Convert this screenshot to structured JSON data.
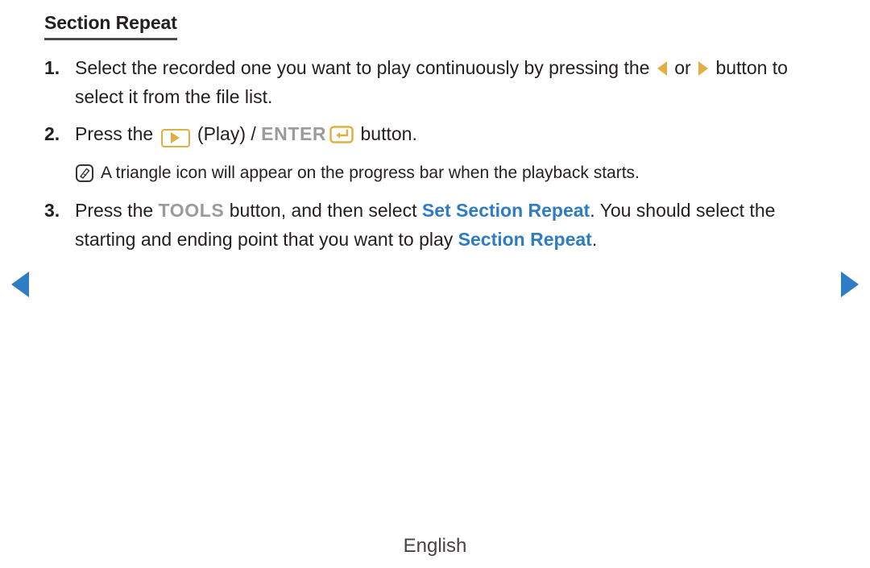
{
  "page": {
    "heading": "Section Repeat",
    "footer_label": "English",
    "background_color": "#ffffff",
    "text_color": "#231f20",
    "accent_blue": "#2e7cc4",
    "accent_gold": "#e0b044",
    "key_gray": "#9b9b9b"
  },
  "steps": [
    {
      "number": "1.",
      "text_part_1": "Select the recorded one you want to play continuously by pressing the ",
      "icon_left": "left-arrow-icon",
      "text_part_2": " or ",
      "icon_right": "right-arrow-icon",
      "text_part_3": " button to select it from the file list."
    },
    {
      "number": "2.",
      "text_part_1": "Press the ",
      "icon_play": "play-button-icon",
      "text_part_2": " (Play) / ",
      "key_label": "ENTER",
      "icon_enter": "enter-key-icon",
      "text_part_3": " button."
    },
    {
      "number": "3.",
      "text_part_1": "Press the ",
      "key_label": "TOOLS",
      "text_part_2": " button, and then select ",
      "highlight_1": "Set Section Repeat",
      "text_part_3": ". You should select the starting and ending point that you want to play ",
      "highlight_2": "Section Repeat",
      "text_part_4": "."
    }
  ],
  "note": {
    "icon": "note-icon",
    "text": "A triangle icon will appear on the progress bar when the playback starts."
  },
  "navigation": {
    "previous_icon": "previous-page-arrow-icon",
    "next_icon": "next-page-arrow-icon"
  }
}
